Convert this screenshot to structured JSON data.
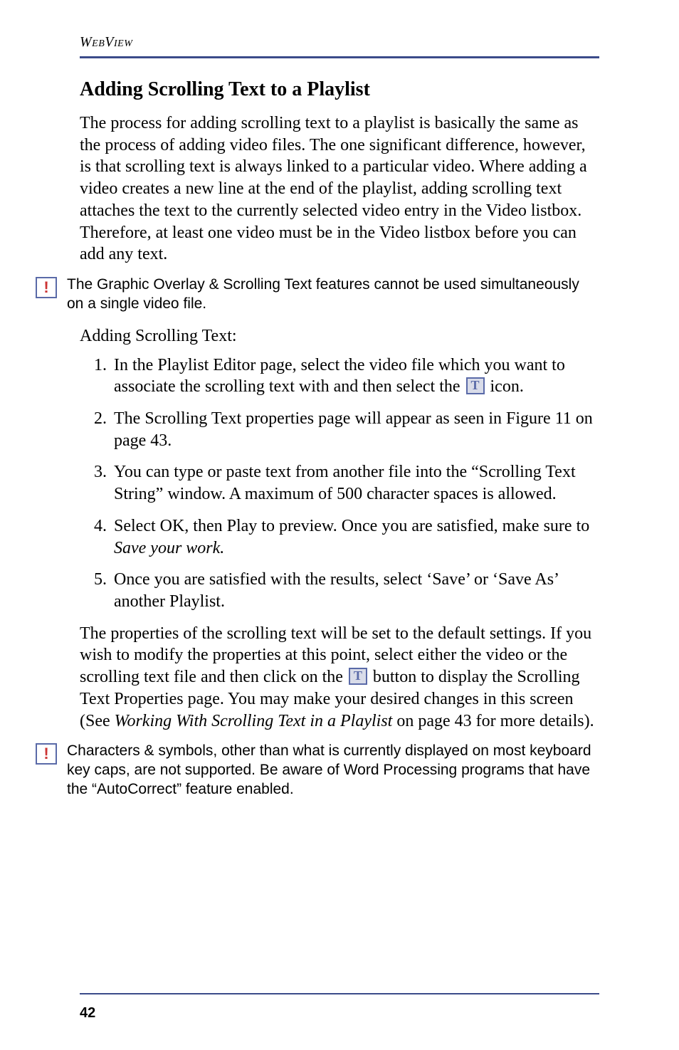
{
  "header": {
    "running": "WebView"
  },
  "section": {
    "title": "Adding Scrolling Text to a Playlist"
  },
  "para1": "The process for adding scrolling text to a playlist is basically the same as the process of adding video files. The one significant difference, however, is that scrolling text is always linked to a particular video. Where adding a video creates a new line at the end of the playlist, adding scrolling text attaches the text to the currently selected video entry in the Video listbox. Therefore, at least one video must be in the Video listbox before you can add any text.",
  "note1": "The Graphic Overlay & Scrolling Text features cannot be used simultaneously on a single video file.",
  "subhead": "Adding Scrolling Text:",
  "steps": {
    "s1a": "In the Playlist Editor page, select the video file which you want to associate the scrolling text with and then select the ",
    "s1b": " icon.",
    "s2": "The Scrolling Text properties page will appear as seen in Figure 11 on page 43.",
    "s3": "You can type or paste text from another file into the “Scrolling Text String” window. A maximum of 500 character spaces is allowed.",
    "s4a": "Select OK, then Play to preview. Once you are satisfied, make sure to ",
    "s4em": "Save your work.",
    "s5": "Once you are satisfied with the results, select ‘Save’ or ‘Save As’ another Playlist."
  },
  "para2a": "The properties of the scrolling text will be set to the default settings. If you wish to modify the properties at this point, select either the video or the scrolling text file and then click on the ",
  "para2b": " button to display the Scrolling Text Properties page. You may make your desired changes in this screen (See ",
  "para2em": "Working With Scrolling Text in a Playlist",
  "para2c": " on page 43 for more details).",
  "note2": "Characters & symbols, other than what is currently displayed on most keyboard key caps, are not supported. Be aware of Word Processing programs that have the “AutoCorrect” feature enabled.",
  "pagenum": "42"
}
